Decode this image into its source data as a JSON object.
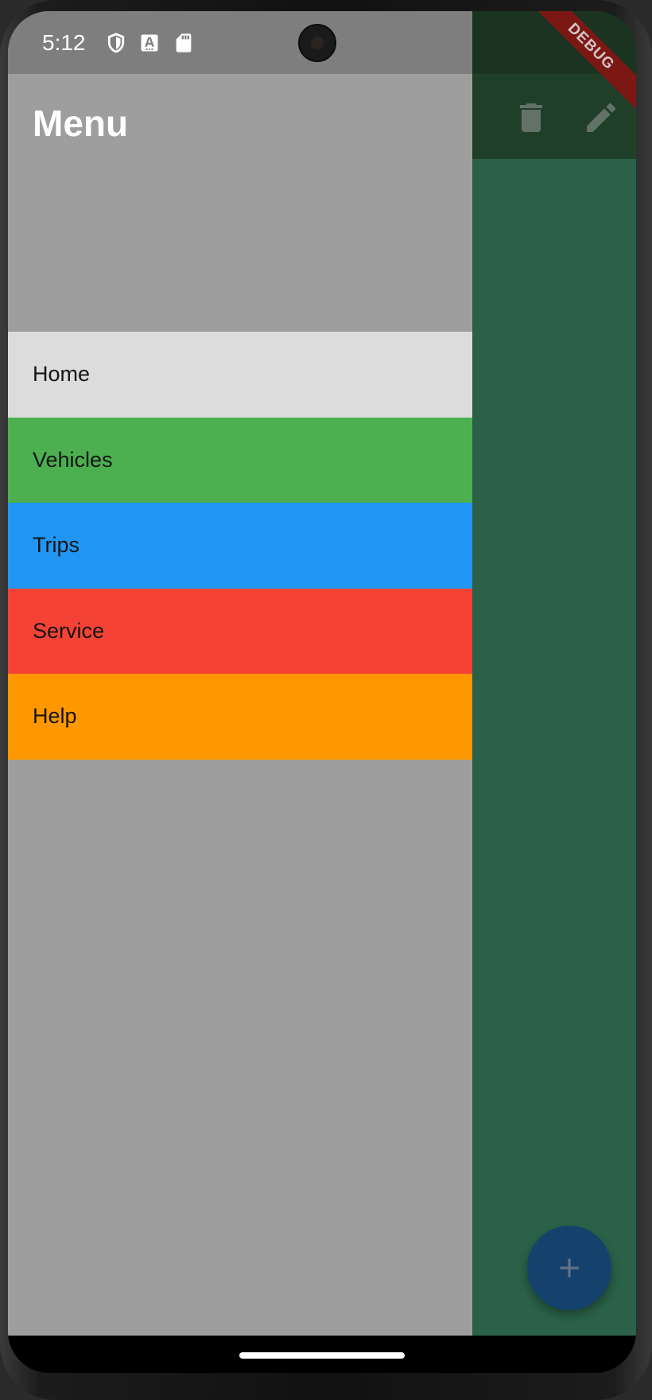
{
  "status_bar": {
    "time": "5:12",
    "icons": [
      "shield-icon",
      "keyboard-a-icon",
      "sd-card-icon"
    ]
  },
  "drawer": {
    "title": "Menu",
    "items": [
      {
        "label": "Home",
        "color": "#dcdcdc"
      },
      {
        "label": "Vehicles",
        "color": "#4caf50"
      },
      {
        "label": "Trips",
        "color": "#2196f3"
      },
      {
        "label": "Service",
        "color": "#f44336"
      },
      {
        "label": "Help",
        "color": "#ff9800"
      }
    ]
  },
  "app_bar": {
    "actions": [
      "delete-icon",
      "edit-icon"
    ]
  },
  "debug_banner": "DEBUG",
  "fab": {
    "icon": "add-icon"
  }
}
